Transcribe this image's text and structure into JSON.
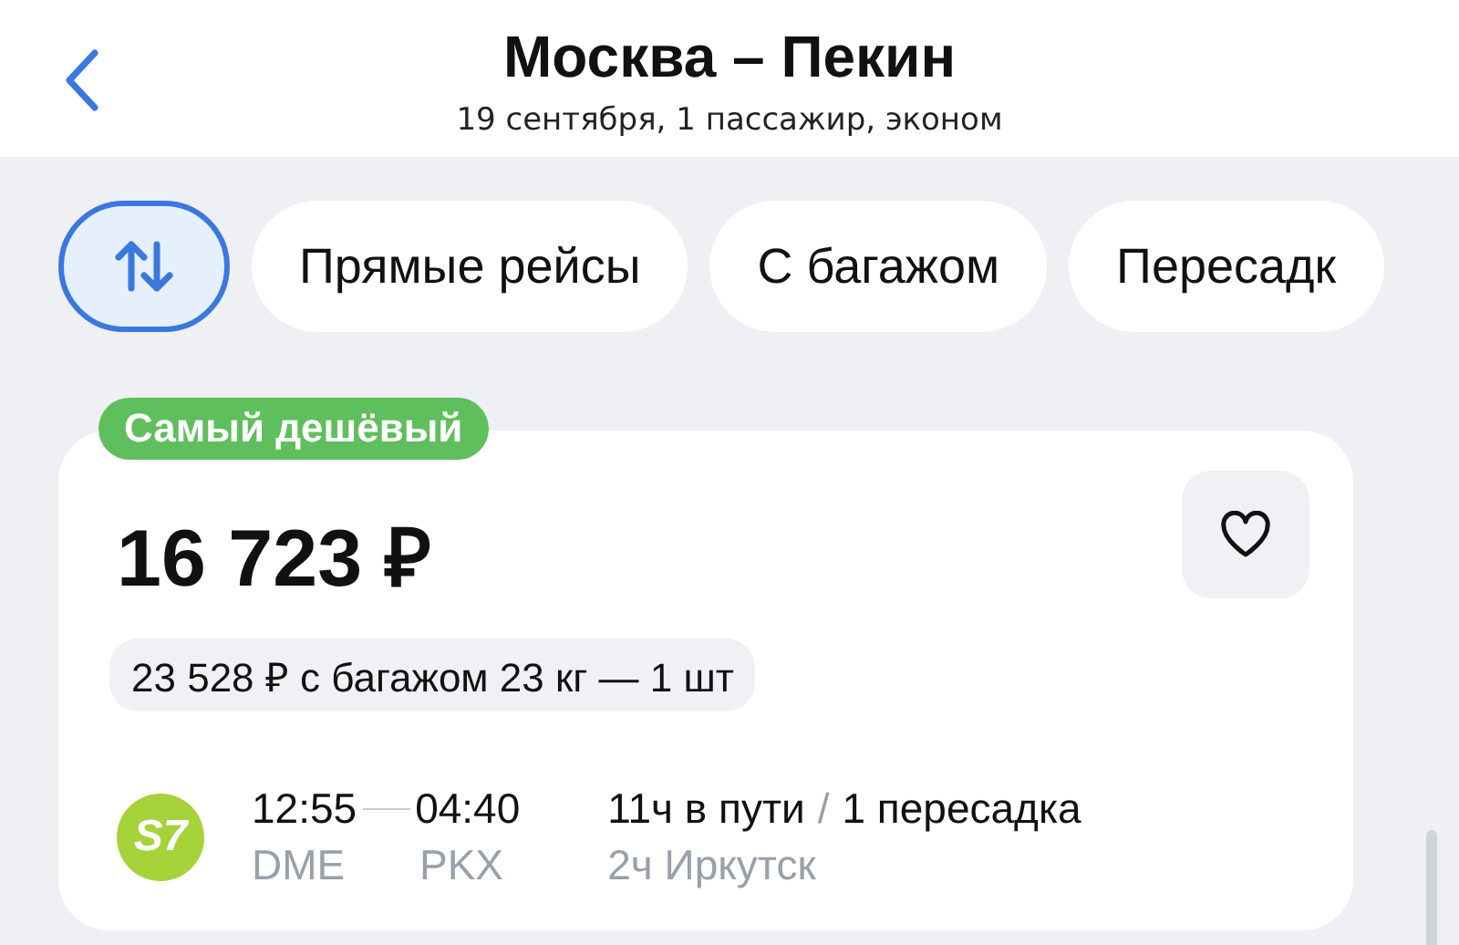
{
  "header": {
    "title": "Москва – Пекин",
    "subtitle": "19 сентября, 1 пассажир, эконом"
  },
  "sort_button": {
    "selected": true
  },
  "filters": [
    {
      "label": "Прямые рейсы",
      "selected": false
    },
    {
      "label": "С багажом",
      "selected": false
    },
    {
      "label": "Пересадк",
      "selected": false
    }
  ],
  "ticket": {
    "badge": "Самый дешёвый",
    "price": "16 723 ₽",
    "favorite": false,
    "baggage_price": "23 528 ₽ с багажом 23 кг — 1 шт",
    "airline_logo": "S7",
    "departure_time": "12:55",
    "arrival_time": "04:40",
    "departure_airport": "DME",
    "arrival_airport": "PKX",
    "duration": "11ч в пути",
    "separator": "/",
    "stops": "1 пересадка",
    "layover": "2ч Иркутск"
  }
}
